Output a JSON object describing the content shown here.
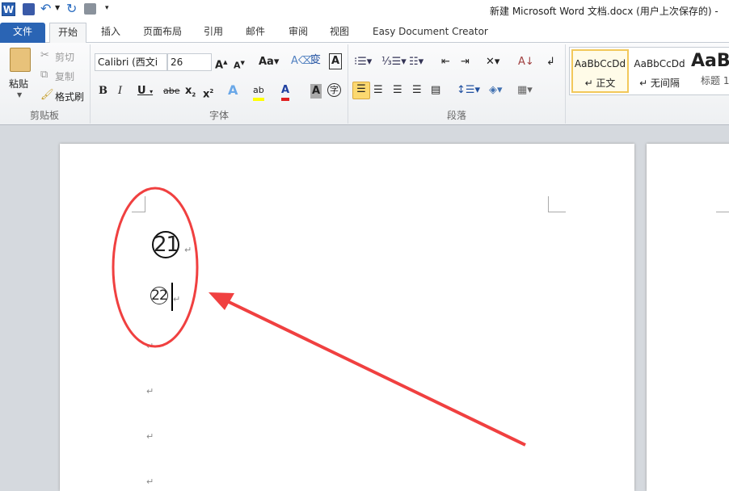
{
  "title": "新建 Microsoft Word 文档.docx (用户上次保存的) - ",
  "quick_access": {
    "icons": [
      "word-logo-icon",
      "save-icon",
      "undo-icon",
      "redo-icon",
      "print-preview-icon",
      "customize-icon"
    ]
  },
  "tabs": [
    {
      "label": "文件"
    },
    {
      "label": "开始"
    },
    {
      "label": "插入"
    },
    {
      "label": "页面布局"
    },
    {
      "label": "引用"
    },
    {
      "label": "邮件"
    },
    {
      "label": "审阅"
    },
    {
      "label": "视图"
    },
    {
      "label": "Easy Document Creator"
    }
  ],
  "clipboard": {
    "paste": "粘贴",
    "cut": "剪切",
    "copy": "复制",
    "format_painter": "格式刷",
    "label": "剪贴板"
  },
  "font": {
    "name": "Calibri (西文i",
    "size": "26",
    "label": "字体"
  },
  "paragraph": {
    "label": "段落"
  },
  "styles": [
    {
      "preview": "AaBbCcDd",
      "name": "↵ 正文"
    },
    {
      "preview": "AaBbCcDd",
      "name": "↵ 无间隔"
    },
    {
      "preview": "AaB",
      "name": "标题 1"
    }
  ],
  "document": {
    "line1": "21",
    "line2": "22",
    "para_mark": "↵"
  },
  "colors": {
    "accent": "#2a64b4",
    "annotation": "#f04040"
  }
}
